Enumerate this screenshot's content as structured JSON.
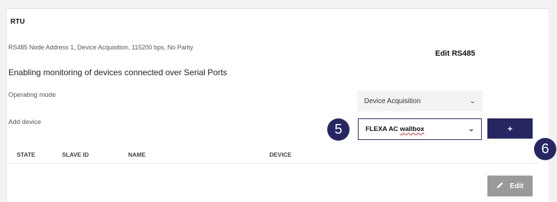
{
  "panel": {
    "title": "RTU",
    "subtitle": "RS485 Node Address 1, Device Acquisition, 115200 bps, No Parity",
    "edit_link": "Edit RS485",
    "description": "Enabling monitoring of devices connected over Serial Ports"
  },
  "operating_mode": {
    "label": "Operating mode",
    "selected": "Device Acquisition"
  },
  "add_device": {
    "label": "Add device",
    "selected_prefix": "FLEXA AC ",
    "selected_suffix": "wallbox",
    "add_label": "+"
  },
  "badges": {
    "step5": "5",
    "step6": "6"
  },
  "table": {
    "columns": [
      "STATE",
      "SLAVE ID",
      "NAME",
      "DEVICE"
    ]
  },
  "footer": {
    "edit_label": "Edit"
  },
  "icons": {
    "chevron": "chevron-down-icon",
    "pencil": "pencil-icon"
  },
  "colors": {
    "accent": "#262663",
    "edit_button": "#9a9a9a",
    "card": "#ffffff",
    "background": "#f2f2f2"
  }
}
